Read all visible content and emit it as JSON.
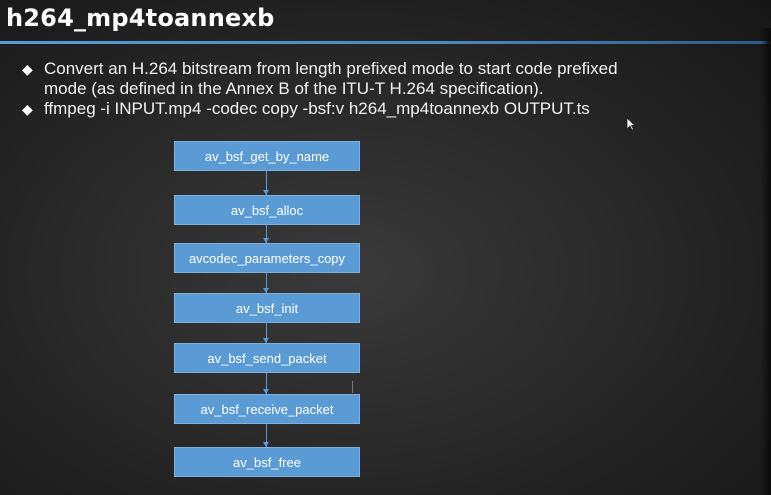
{
  "slide": {
    "title": "h264_mp4toannexb",
    "bullets": [
      {
        "marker": "◆",
        "lines": [
          "Convert an H.264 bitstream from length prefixed mode to start code prefixed",
          "mode (as defined in the Annex B of the ITU-T H.264 specification)."
        ]
      },
      {
        "marker": "◆",
        "lines": [
          "ffmpeg -i INPUT.mp4 -codec copy -bsf:v h264_mp4toannexb OUTPUT.ts"
        ]
      }
    ]
  },
  "flowchart": {
    "steps": [
      "av_bsf_get_by_name",
      "av_bsf_alloc",
      "avcodec_parameters_copy",
      "av_bsf_init",
      "av_bsf_send_packet",
      "av_bsf_receive_packet",
      "av_bsf_free"
    ]
  },
  "colors": {
    "box_fill": "#5b9bd5",
    "title_rule": "#5b9bd5",
    "background": "#2a2a2a"
  }
}
